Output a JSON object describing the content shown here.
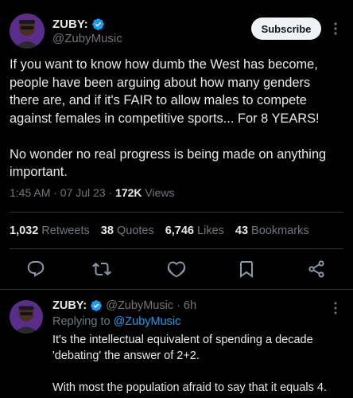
{
  "tweet": {
    "author": {
      "display_name": "ZUBY:",
      "handle": "@ZubyMusic",
      "avatar_icon": "avatar-image",
      "verified_icon": "verified-badge-icon"
    },
    "subscribe_label": "Subscribe",
    "text": "If you want to know how dumb the West has become, people have been arguing about how many genders there are, and if it's FAIR to allow males to compete against females in competitive sports... For 8 YEARS!\n\nNo wonder no real progress is being made on anything important.",
    "time": "1:45 AM · 07 Jul 23 · ",
    "views_count": "172K",
    "views_label": " Views",
    "stats": {
      "retweets_num": "1,032",
      "retweets_label": " Retweets",
      "quotes_num": "38",
      "quotes_label": " Quotes",
      "likes_num": "6,746",
      "likes_label": " Likes",
      "bookmarks_num": "43",
      "bookmarks_label": " Bookmarks"
    },
    "action_icons": [
      "reply-icon",
      "retweet-icon",
      "like-icon",
      "bookmark-icon",
      "share-icon"
    ]
  },
  "reply": {
    "display_name": "ZUBY:",
    "handle": "@ZubyMusic",
    "age": "· 6h",
    "replying_prefix": "Replying to ",
    "replying_to": "@ZubyMusic",
    "text": "It's the intellectual equivalent of spending a decade 'debating' the answer of 2+2.\n\nWith most the population afraid to say that it equals 4."
  },
  "colors": {
    "background": "#000000",
    "text": "#e7e9ea",
    "muted": "#71767b",
    "accent": "#1d9bf0",
    "divider": "#2f3336"
  }
}
